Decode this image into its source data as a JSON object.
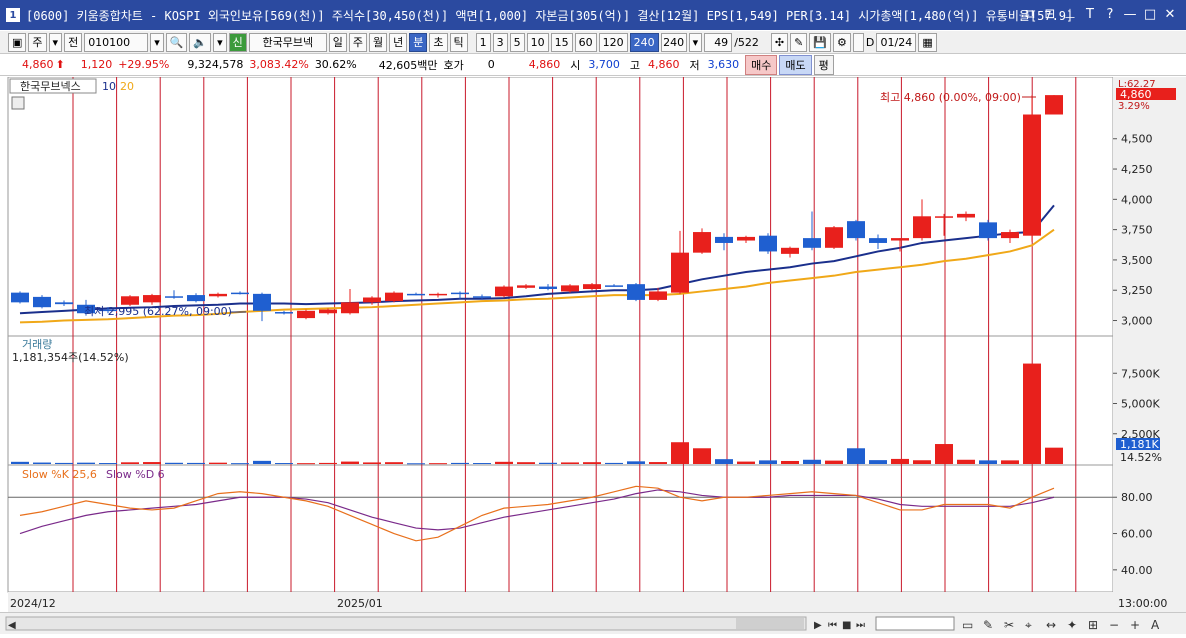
{
  "titlebar": {
    "num": "1",
    "text": "[0600] 키움종합차트 - KOSPI 외국인보유[569(천)] 주식수[30,450(천)] 액면[1,000] 자본금[305(억)] 결산[12월] EPS[1,549] PER[3.14] 시가총액[1,480(억)] 유통비율[57.9]"
  },
  "toolbar": {
    "period_type": "주",
    "prev": "전",
    "code": "010100",
    "new_label": "신",
    "stock_name": "한국무브넥",
    "periods": [
      "일",
      "주",
      "월",
      "년",
      "분",
      "초",
      "틱"
    ],
    "selected_period": "분",
    "minutes": [
      "1",
      "3",
      "5",
      "10",
      "15",
      "60",
      "120",
      "240"
    ],
    "selected_minute": "240",
    "minute_value": "240",
    "count": "49",
    "total": "/522",
    "date": "01/24"
  },
  "info": {
    "price": "4,860",
    "change": "1,120",
    "rate": "+29.95%",
    "volume": "9,324,578",
    "vol_rate": "3,083.42%",
    "turnover": "30.62%",
    "amount": "42,605백만",
    "quote_label": "호가",
    "quote_value": "0",
    "quote_price": "4,860",
    "open_label": "시",
    "open": "3,700",
    "high_label": "고",
    "high": "4,860",
    "low_label": "저",
    "low": "3,630",
    "buy": "매수",
    "sell": "매도",
    "eval": "평"
  },
  "chart": {
    "legend_name": "한국무브넥스",
    "ma1": "10",
    "ma2": "20",
    "high_note": "최고 4,860 (0.00%, 09:00)",
    "low_note": "최저 2,995 (62.27%, 09:00)",
    "top_right_pct": "62.27",
    "price_tag": "4,860",
    "price_tag_pct": "3.29%",
    "vol_title": "거래량",
    "vol_value": "1,181,354주(14.52%)",
    "vol_tag": "1,181K",
    "vol_tag_pct": "14.52%",
    "stoch_label": "Slow %K 25,6",
    "stoch_label2": "Slow %D 6",
    "x_labels": [
      "2024/12",
      "2025/01"
    ],
    "time_label": "13:00:00",
    "colors": {
      "up": "#e8201c",
      "down": "#1f5fd0",
      "ma10": "#1a2f8c",
      "ma20": "#f0a818",
      "grid": "#c8182a"
    }
  },
  "chart_data": {
    "type": "candlestick",
    "price_axis": {
      "ticks": [
        3000,
        3250,
        3500,
        3750,
        4000,
        4250,
        4500
      ],
      "labels": [
        "3,000",
        "3,250",
        "3,500",
        "3,750",
        "4,000",
        "4,250",
        "4,500"
      ],
      "ylim": [
        2930,
        4960
      ]
    },
    "volume_axis": {
      "ticks": [
        2500,
        5000,
        7500
      ],
      "labels": [
        "2,500K",
        "5,000K",
        "7,500K"
      ],
      "ylim": [
        0,
        10000
      ]
    },
    "stoch_axis": {
      "ticks": [
        40,
        60,
        80
      ],
      "labels": [
        "40.00",
        "60.00",
        "80.00"
      ],
      "ylim": [
        30,
        95
      ]
    },
    "candles": [
      {
        "o": 3230,
        "h": 3240,
        "l": 3140,
        "c": 3150
      },
      {
        "o": 3195,
        "h": 3210,
        "l": 3100,
        "c": 3110
      },
      {
        "o": 3150,
        "h": 3165,
        "l": 3120,
        "c": 3135
      },
      {
        "o": 3130,
        "h": 3170,
        "l": 3040,
        "c": 3060
      },
      {
        "o": 3090,
        "h": 3110,
        "l": 3060,
        "c": 3080
      },
      {
        "o": 3130,
        "h": 3210,
        "l": 3120,
        "c": 3200
      },
      {
        "o": 3150,
        "h": 3220,
        "l": 3130,
        "c": 3210
      },
      {
        "o": 3200,
        "h": 3250,
        "l": 3180,
        "c": 3190
      },
      {
        "o": 3210,
        "h": 3225,
        "l": 3150,
        "c": 3160
      },
      {
        "o": 3200,
        "h": 3230,
        "l": 3190,
        "c": 3220
      },
      {
        "o": 3230,
        "h": 3240,
        "l": 3215,
        "c": 3225
      },
      {
        "o": 3220,
        "h": 3230,
        "l": 2995,
        "c": 3080
      },
      {
        "o": 3070,
        "h": 3080,
        "l": 3050,
        "c": 3060
      },
      {
        "o": 3020,
        "h": 3090,
        "l": 3010,
        "c": 3080
      },
      {
        "o": 3060,
        "h": 3100,
        "l": 3050,
        "c": 3090
      },
      {
        "o": 3060,
        "h": 3260,
        "l": 3050,
        "c": 3150
      },
      {
        "o": 3150,
        "h": 3200,
        "l": 3130,
        "c": 3190
      },
      {
        "o": 3160,
        "h": 3240,
        "l": 3150,
        "c": 3230
      },
      {
        "o": 3220,
        "h": 3230,
        "l": 3210,
        "c": 3215
      },
      {
        "o": 3210,
        "h": 3230,
        "l": 3190,
        "c": 3220
      },
      {
        "o": 3230,
        "h": 3240,
        "l": 3180,
        "c": 3220
      },
      {
        "o": 3200,
        "h": 3215,
        "l": 3180,
        "c": 3190
      },
      {
        "o": 3200,
        "h": 3290,
        "l": 3190,
        "c": 3280
      },
      {
        "o": 3270,
        "h": 3300,
        "l": 3260,
        "c": 3290
      },
      {
        "o": 3280,
        "h": 3300,
        "l": 3250,
        "c": 3260
      },
      {
        "o": 3240,
        "h": 3300,
        "l": 3230,
        "c": 3290
      },
      {
        "o": 3260,
        "h": 3310,
        "l": 3250,
        "c": 3300
      },
      {
        "o": 3290,
        "h": 3300,
        "l": 3280,
        "c": 3285
      },
      {
        "o": 3300,
        "h": 3310,
        "l": 3160,
        "c": 3170
      },
      {
        "o": 3170,
        "h": 3270,
        "l": 3160,
        "c": 3240
      },
      {
        "o": 3230,
        "h": 3740,
        "l": 3220,
        "c": 3560
      },
      {
        "o": 3560,
        "h": 3760,
        "l": 3550,
        "c": 3730
      },
      {
        "o": 3690,
        "h": 3720,
        "l": 3580,
        "c": 3640
      },
      {
        "o": 3660,
        "h": 3700,
        "l": 3640,
        "c": 3690
      },
      {
        "o": 3700,
        "h": 3720,
        "l": 3550,
        "c": 3570
      },
      {
        "o": 3550,
        "h": 3610,
        "l": 3520,
        "c": 3600
      },
      {
        "o": 3680,
        "h": 3900,
        "l": 3580,
        "c": 3600
      },
      {
        "o": 3600,
        "h": 3780,
        "l": 3590,
        "c": 3770
      },
      {
        "o": 3820,
        "h": 3830,
        "l": 3660,
        "c": 3680
      },
      {
        "o": 3680,
        "h": 3710,
        "l": 3590,
        "c": 3640
      },
      {
        "o": 3660,
        "h": 3680,
        "l": 3570,
        "c": 3680
      },
      {
        "o": 3680,
        "h": 4000,
        "l": 3660,
        "c": 3860
      },
      {
        "o": 3860,
        "h": 3880,
        "l": 3700,
        "c": 3860
      },
      {
        "o": 3850,
        "h": 3900,
        "l": 3820,
        "c": 3880
      },
      {
        "o": 3810,
        "h": 3830,
        "l": 3660,
        "c": 3680
      },
      {
        "o": 3680,
        "h": 3750,
        "l": 3640,
        "c": 3730
      },
      {
        "o": 3700,
        "h": 4860,
        "l": 3650,
        "c": 4700
      },
      {
        "o": 4700,
        "h": 4860,
        "l": 4700,
        "c": 4860
      }
    ],
    "volume": [
      180,
      120,
      90,
      110,
      80,
      140,
      160,
      100,
      90,
      110,
      70,
      260,
      80,
      70,
      90,
      200,
      130,
      150,
      60,
      70,
      90,
      80,
      180,
      150,
      100,
      130,
      150,
      90,
      220,
      160,
      1800,
      1300,
      400,
      200,
      300,
      250,
      350,
      280,
      1300,
      320,
      420,
      310,
      1650,
      350,
      300,
      300,
      8300,
      1350
    ],
    "ma10": [
      3060,
      3070,
      3080,
      3090,
      3100,
      3105,
      3110,
      3120,
      3125,
      3130,
      3140,
      3140,
      3140,
      3135,
      3140,
      3145,
      3150,
      3160,
      3165,
      3170,
      3180,
      3180,
      3185,
      3200,
      3220,
      3230,
      3240,
      3250,
      3250,
      3260,
      3300,
      3340,
      3370,
      3400,
      3420,
      3440,
      3470,
      3490,
      3530,
      3570,
      3600,
      3640,
      3660,
      3680,
      3700,
      3720,
      3730,
      3950
    ],
    "ma20": [
      2985,
      2990,
      3000,
      3005,
      3010,
      3020,
      3030,
      3040,
      3045,
      3055,
      3070,
      3080,
      3090,
      3095,
      3100,
      3105,
      3110,
      3120,
      3130,
      3140,
      3150,
      3160,
      3165,
      3175,
      3180,
      3190,
      3200,
      3210,
      3210,
      3210,
      3220,
      3240,
      3260,
      3280,
      3310,
      3330,
      3350,
      3370,
      3400,
      3420,
      3440,
      3460,
      3490,
      3510,
      3540,
      3570,
      3620,
      3750
    ],
    "slow_k": [
      70,
      72,
      75,
      78,
      76,
      74,
      73,
      74,
      78,
      82,
      83,
      82,
      80,
      78,
      75,
      70,
      65,
      60,
      56,
      58,
      64,
      70,
      74,
      75,
      76,
      78,
      80,
      83,
      86,
      85,
      80,
      78,
      80,
      80,
      81,
      82,
      83,
      82,
      81,
      77,
      73,
      73,
      76,
      76,
      76,
      74,
      80,
      85
    ],
    "slow_d": [
      60,
      64,
      67,
      70,
      72,
      73,
      74,
      75,
      76,
      78,
      80,
      80,
      80,
      79,
      77,
      73,
      69,
      66,
      63,
      62,
      63,
      66,
      69,
      71,
      73,
      75,
      77,
      79,
      82,
      84,
      83,
      81,
      80,
      80,
      80,
      81,
      81,
      81,
      81,
      79,
      76,
      75,
      75,
      75,
      75,
      75,
      77,
      80
    ]
  }
}
